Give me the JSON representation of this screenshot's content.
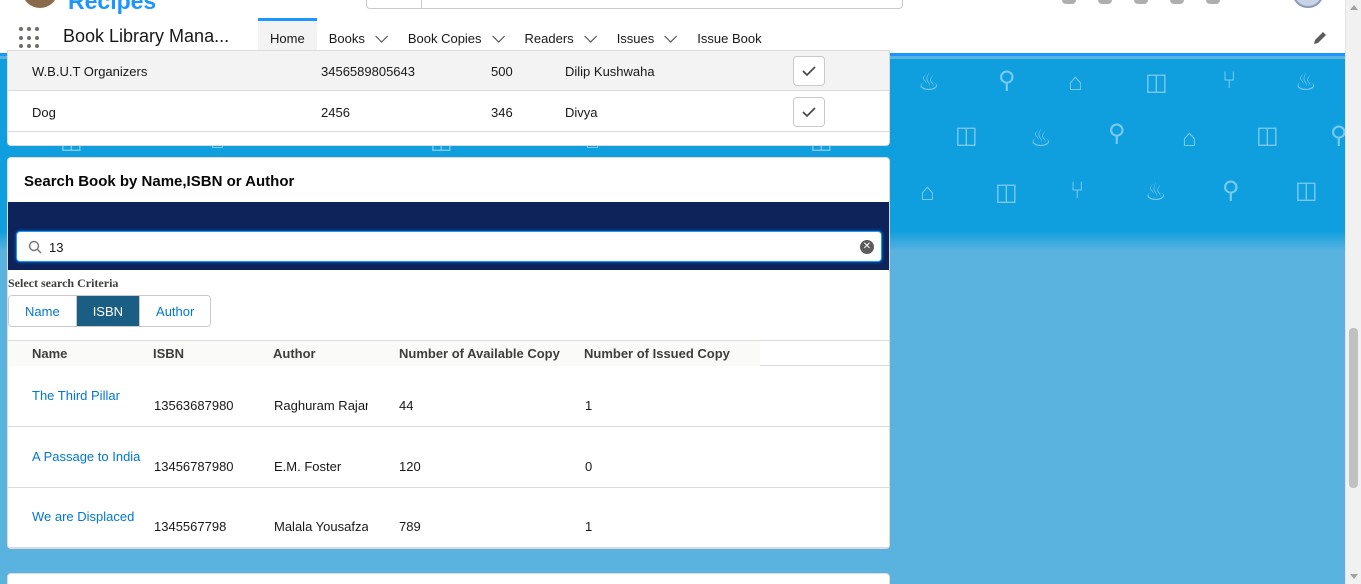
{
  "header": {
    "brand": "Recipes",
    "app_name": "Book Library Mana...",
    "tabs": [
      {
        "label": "Home",
        "active": true,
        "has_menu": false
      },
      {
        "label": "Books",
        "active": false,
        "has_menu": true
      },
      {
        "label": "Book Copies",
        "active": false,
        "has_menu": true
      },
      {
        "label": "Readers",
        "active": false,
        "has_menu": true
      },
      {
        "label": "Issues",
        "active": false,
        "has_menu": true
      },
      {
        "label": "Issue Book",
        "active": false,
        "has_menu": false
      }
    ]
  },
  "issue_rows": [
    {
      "name": "W.B.U.T Organizers",
      "isbn": "3456589805643",
      "count": "500",
      "reader": "Dilip Kushwaha"
    },
    {
      "name": "Dog",
      "isbn": "2456",
      "count": "346",
      "reader": "Divya"
    }
  ],
  "search_card": {
    "title": "Search Book by Name,ISBN or Author",
    "query": "13",
    "criteria_label": "Select search Criteria",
    "criteria": [
      "Name",
      "ISBN",
      "Author"
    ],
    "selected_criteria": "ISBN",
    "columns": [
      "Name",
      "ISBN",
      "Author",
      "Number of Available Copy",
      "Number of Issued Copy"
    ],
    "results": [
      {
        "name": "The Third Pillar",
        "isbn": "13563687980",
        "author": "Raghuram Rajan",
        "available": "44",
        "issued": "1"
      },
      {
        "name": "A Passage to India",
        "isbn": "13456787980",
        "author": "E.M. Foster",
        "available": "120",
        "issued": "0"
      },
      {
        "name": "We are Displaced",
        "isbn": "1345567798",
        "author": "Malala Yousafzai",
        "available": "789",
        "issued": "1"
      }
    ]
  },
  "colors": {
    "brand_blue": "#1b96ff",
    "link": "#0176d3",
    "navy": "#0d2359",
    "selected_segment": "#1b5e83",
    "banner": "#0f9fdf",
    "background": "#5ab2df"
  },
  "icons": [
    "waffle-icon",
    "chevron-down-icon",
    "edit-icon",
    "check-icon",
    "search-icon",
    "clear-icon"
  ]
}
